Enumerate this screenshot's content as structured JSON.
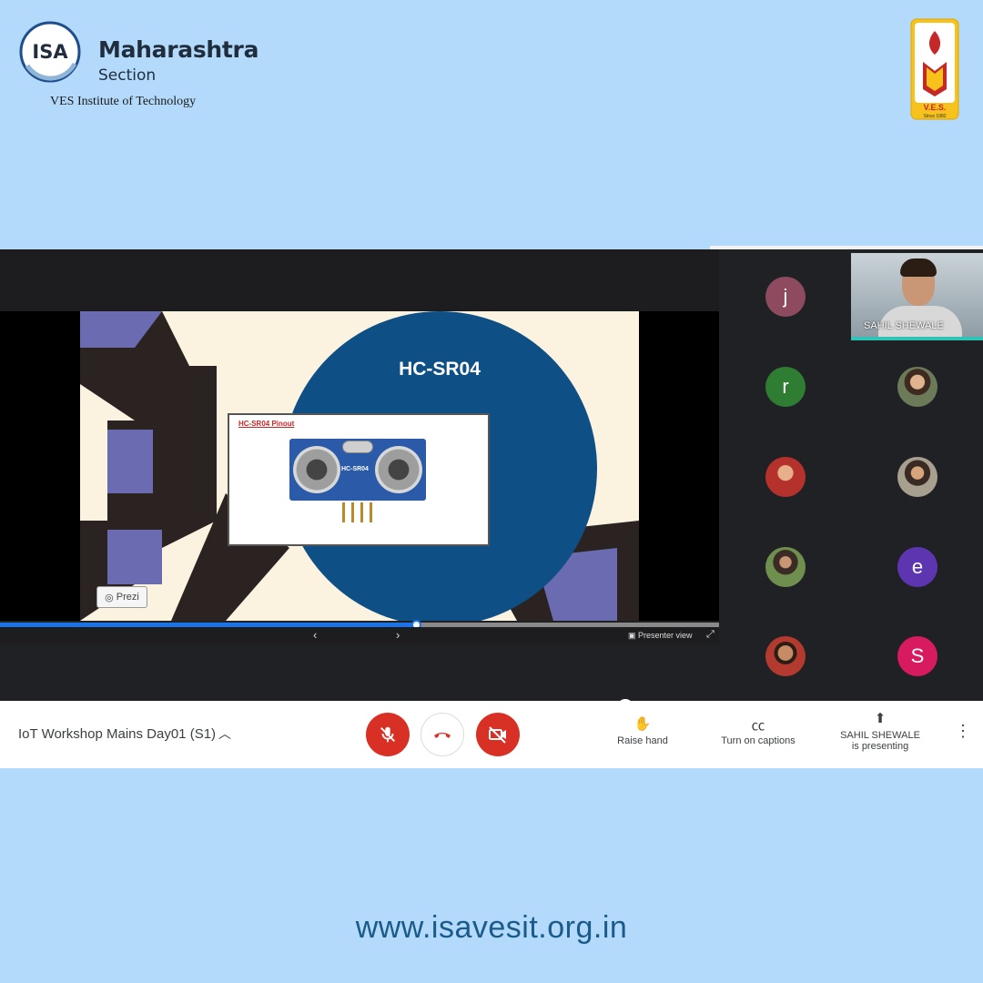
{
  "branding": {
    "isa_logo_text": "ISA",
    "org_name": "Maharashtra",
    "org_section": "Section",
    "institute": "VES Institute of Technology",
    "ves_logo_text": "V.E.S.",
    "ves_since": "Since 1982"
  },
  "slide": {
    "title": "HC-SR04",
    "pinout_title": "HC-SR04 Pinout",
    "sensor_label": "HC-SR04",
    "prezi_label": "Prezi"
  },
  "prezi_controls": {
    "progress_fraction": 0.578,
    "presenter_view_label": "Presenter view"
  },
  "participants": [
    {
      "initial": "j",
      "color": "#8e4a5f"
    },
    {
      "initial": "r",
      "color": "#2e7d32"
    },
    {
      "initial": "e",
      "color": "#5e35b1"
    },
    {
      "initial": "S",
      "color": "#d81b60"
    }
  ],
  "self_view": {
    "name": "SAHIL SHEWALE"
  },
  "meet_bar": {
    "meeting_title": "IoT Workshop Mains Day01 (S1)",
    "raise_hand_label": "Raise hand",
    "captions_label": "Turn on captions",
    "presenter_name": "SAHIL SHEWALE",
    "presenting_label": "is presenting"
  },
  "footer": {
    "website": "www.isavesit.org.in"
  },
  "colors": {
    "page_background": "#b3d9fb",
    "meet_dark": "#202124",
    "danger_red": "#d93025",
    "accent_blue": "#1a73e8"
  }
}
